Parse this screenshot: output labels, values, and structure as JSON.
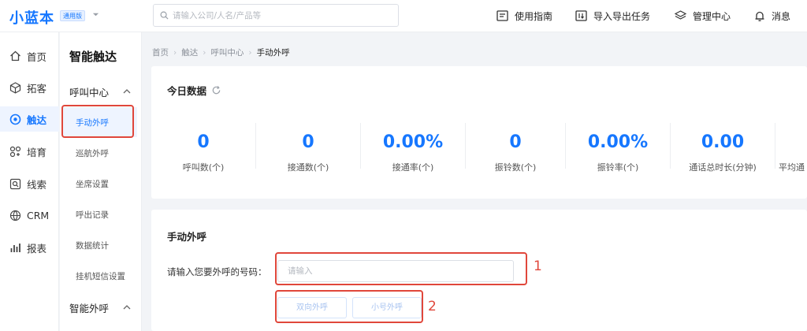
{
  "header": {
    "logo": "小蓝本",
    "edition": "通用版",
    "search_placeholder": "请输入公司/人名/产品等",
    "nav": [
      {
        "label": "使用指南",
        "icon": "guide-icon"
      },
      {
        "label": "导入导出任务",
        "icon": "import-export-icon"
      },
      {
        "label": "管理中心",
        "icon": "layers-icon"
      },
      {
        "label": "消息",
        "icon": "bell-icon"
      }
    ]
  },
  "sidebar": {
    "items": [
      {
        "label": "首页",
        "icon": "home-icon"
      },
      {
        "label": "拓客",
        "icon": "cube-icon"
      },
      {
        "label": "触达",
        "icon": "target-icon",
        "active": true
      },
      {
        "label": "培育",
        "icon": "nurture-icon"
      },
      {
        "label": "线索",
        "icon": "clue-icon"
      },
      {
        "label": "CRM",
        "icon": "crm-icon"
      },
      {
        "label": "报表",
        "icon": "report-icon"
      }
    ]
  },
  "subnav": {
    "title": "智能触达",
    "groups": [
      {
        "label": "呼叫中心",
        "expanded": true,
        "items": [
          "手动外呼",
          "巡航外呼",
          "坐席设置",
          "呼出记录",
          "数据统计",
          "挂机短信设置"
        ],
        "active_item": "手动外呼"
      },
      {
        "label": "智能外呼",
        "expanded": true,
        "items": []
      }
    ]
  },
  "breadcrumb": [
    "首页",
    "触达",
    "呼叫中心",
    "手动外呼"
  ],
  "today": {
    "title": "今日数据",
    "stats": [
      {
        "value": "0",
        "label": "呼叫数(个)"
      },
      {
        "value": "0",
        "label": "接通数(个)"
      },
      {
        "value": "0.00%",
        "label": "接通率(个)"
      },
      {
        "value": "0",
        "label": "振铃数(个)"
      },
      {
        "value": "0.00%",
        "label": "振铃率(个)"
      },
      {
        "value": "0.00",
        "label": "通话总时长(分钟)"
      },
      {
        "value": "",
        "label": "平均通"
      }
    ]
  },
  "manual_call": {
    "title": "手动外呼",
    "field_label": "请输入您要外呼的号码：",
    "input_placeholder": "请输入",
    "input_value": "",
    "buttons": [
      "双向外呼",
      "小号外呼"
    ]
  },
  "annotations": [
    "1",
    "2"
  ],
  "colors": {
    "accent": "#1677ff",
    "annotation": "#e0473b"
  }
}
